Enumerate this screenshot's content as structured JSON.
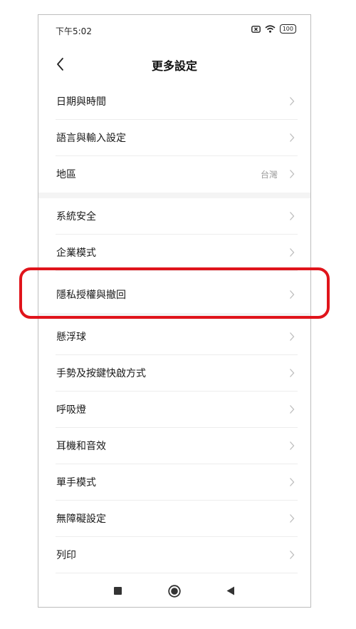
{
  "status_bar": {
    "time": "下午5:02",
    "battery": "100"
  },
  "header": {
    "title": "更多設定"
  },
  "settings_groups": [
    {
      "items": [
        {
          "label": "日期與時間"
        },
        {
          "label": "語言與輸入設定"
        },
        {
          "label": "地區",
          "value": "台灣"
        }
      ]
    },
    {
      "items": [
        {
          "label": "系統安全"
        },
        {
          "label": "企業模式"
        },
        {
          "label": "隱私授權與撤回"
        }
      ]
    },
    {
      "items": [
        {
          "label": "懸浮球"
        },
        {
          "label": "手勢及按鍵快啟方式"
        },
        {
          "label": "呼吸燈"
        },
        {
          "label": "耳機和音效"
        },
        {
          "label": "單手模式"
        },
        {
          "label": "無障礙設定"
        },
        {
          "label": "列印"
        }
      ]
    }
  ],
  "highlight_color": "#e0141b",
  "nav_icons": [
    "recents-square-icon",
    "home-circle-icon",
    "back-triangle-icon"
  ]
}
